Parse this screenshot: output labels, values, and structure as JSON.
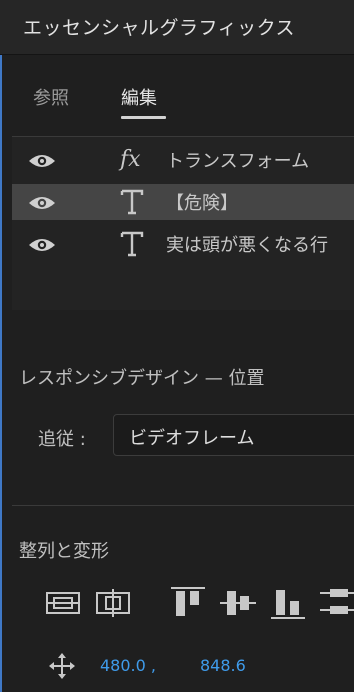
{
  "panel": {
    "title": "エッセンシャルグラフィックス"
  },
  "tabs": [
    {
      "label": "参照",
      "active": false
    },
    {
      "label": "編集",
      "active": true
    }
  ],
  "layers": [
    {
      "icon": "fx-icon",
      "glyph": "fx",
      "name": "トランスフォーム",
      "selected": false
    },
    {
      "icon": "text-layer-icon",
      "glyph": "T",
      "name": "【危険】",
      "selected": true
    },
    {
      "icon": "text-layer-icon",
      "glyph": "T",
      "name": "実は頭が悪くなる行",
      "selected": false
    }
  ],
  "responsive": {
    "title": "レスポンシブデザイン — 位置",
    "follow_label": "追従 :",
    "follow_value": "ビデオフレーム"
  },
  "align": {
    "title": "整列と変形",
    "buttons": [
      "align-vertical-center-icon",
      "align-horizontal-center-icon",
      "align-top-icon",
      "align-vertical-centers-icon",
      "align-bottom-icon",
      "distribute-icon"
    ]
  },
  "position": {
    "x": "480.0 ,",
    "y": "848.6"
  },
  "colors": {
    "accent": "#3f9bea",
    "background": "#1f1f1f",
    "selected_row": "#454545"
  }
}
